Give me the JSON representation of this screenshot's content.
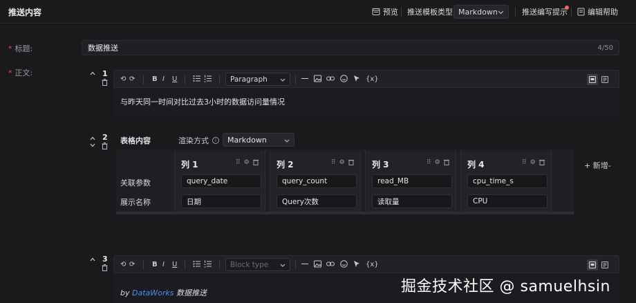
{
  "header": {
    "title": "推送内容",
    "preview_label": "预览",
    "template_type_label": "推送模板类型",
    "template_type_value": "Markdown",
    "writing_tips_label": "推送编写提示",
    "edit_help_label": "编辑帮助"
  },
  "form": {
    "title_label": "标题:",
    "title_value": "数据推送",
    "title_count": "4/50",
    "body_label": "正文:"
  },
  "blocks": [
    {
      "number": "1",
      "block_type": "Paragraph",
      "text": "与昨天同一时间对比过去3小时的数据访问量情况"
    },
    {
      "number": "2",
      "table_label": "表格内容",
      "render_label": "渲染方式",
      "render_value": "Markdown",
      "row_labels": [
        "关联参数",
        "展示名称"
      ],
      "add_column_label": "+ 新增-",
      "columns": [
        {
          "title": "列 1",
          "param": "query_date",
          "display": "日期"
        },
        {
          "title": "列 2",
          "param": "query_count",
          "display": "Query次数"
        },
        {
          "title": "列 3",
          "param": "read_MB",
          "display": "读取量"
        },
        {
          "title": "列 4",
          "param": "cpu_time_s",
          "display": "CPU"
        }
      ]
    },
    {
      "number": "3",
      "block_type_placeholder": "Block type",
      "footer_by": "by",
      "footer_link": "DataWorks",
      "footer_rest": "数据推送"
    }
  ],
  "toolbar": {
    "undo": "⟲",
    "redo": "⟳",
    "bold": "B",
    "italic": "I",
    "underline": "U",
    "code": "{x}"
  },
  "watermark": "掘金技术社区 @ samuelhsin",
  "colors": {
    "background": "#1a1a1d",
    "accent_link": "#4c8df6",
    "required": "#d9534f"
  }
}
